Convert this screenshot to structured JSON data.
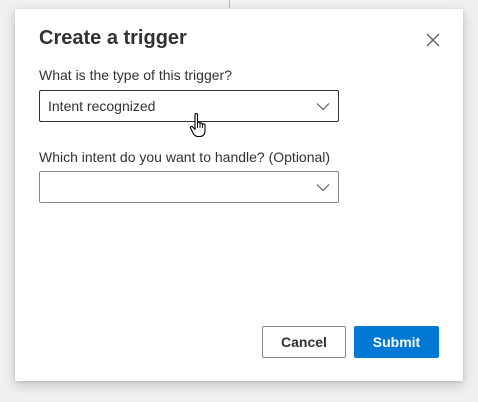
{
  "dialog": {
    "title": "Create a trigger",
    "close_icon": "close-icon"
  },
  "fields": {
    "trigger_type": {
      "label": "What is the type of this trigger?",
      "value": "Intent recognized",
      "icon": "chevron-down-icon"
    },
    "intent": {
      "label": "Which intent do you want to handle? (Optional)",
      "value": "",
      "icon": "chevron-down-icon"
    }
  },
  "buttons": {
    "cancel_label": "Cancel",
    "submit_label": "Submit"
  },
  "colors": {
    "primary": "#0078d4",
    "text": "#323130",
    "border": "#8a8886",
    "backdrop": "#f0f0f0"
  },
  "cursor": "hand-pointer-icon"
}
